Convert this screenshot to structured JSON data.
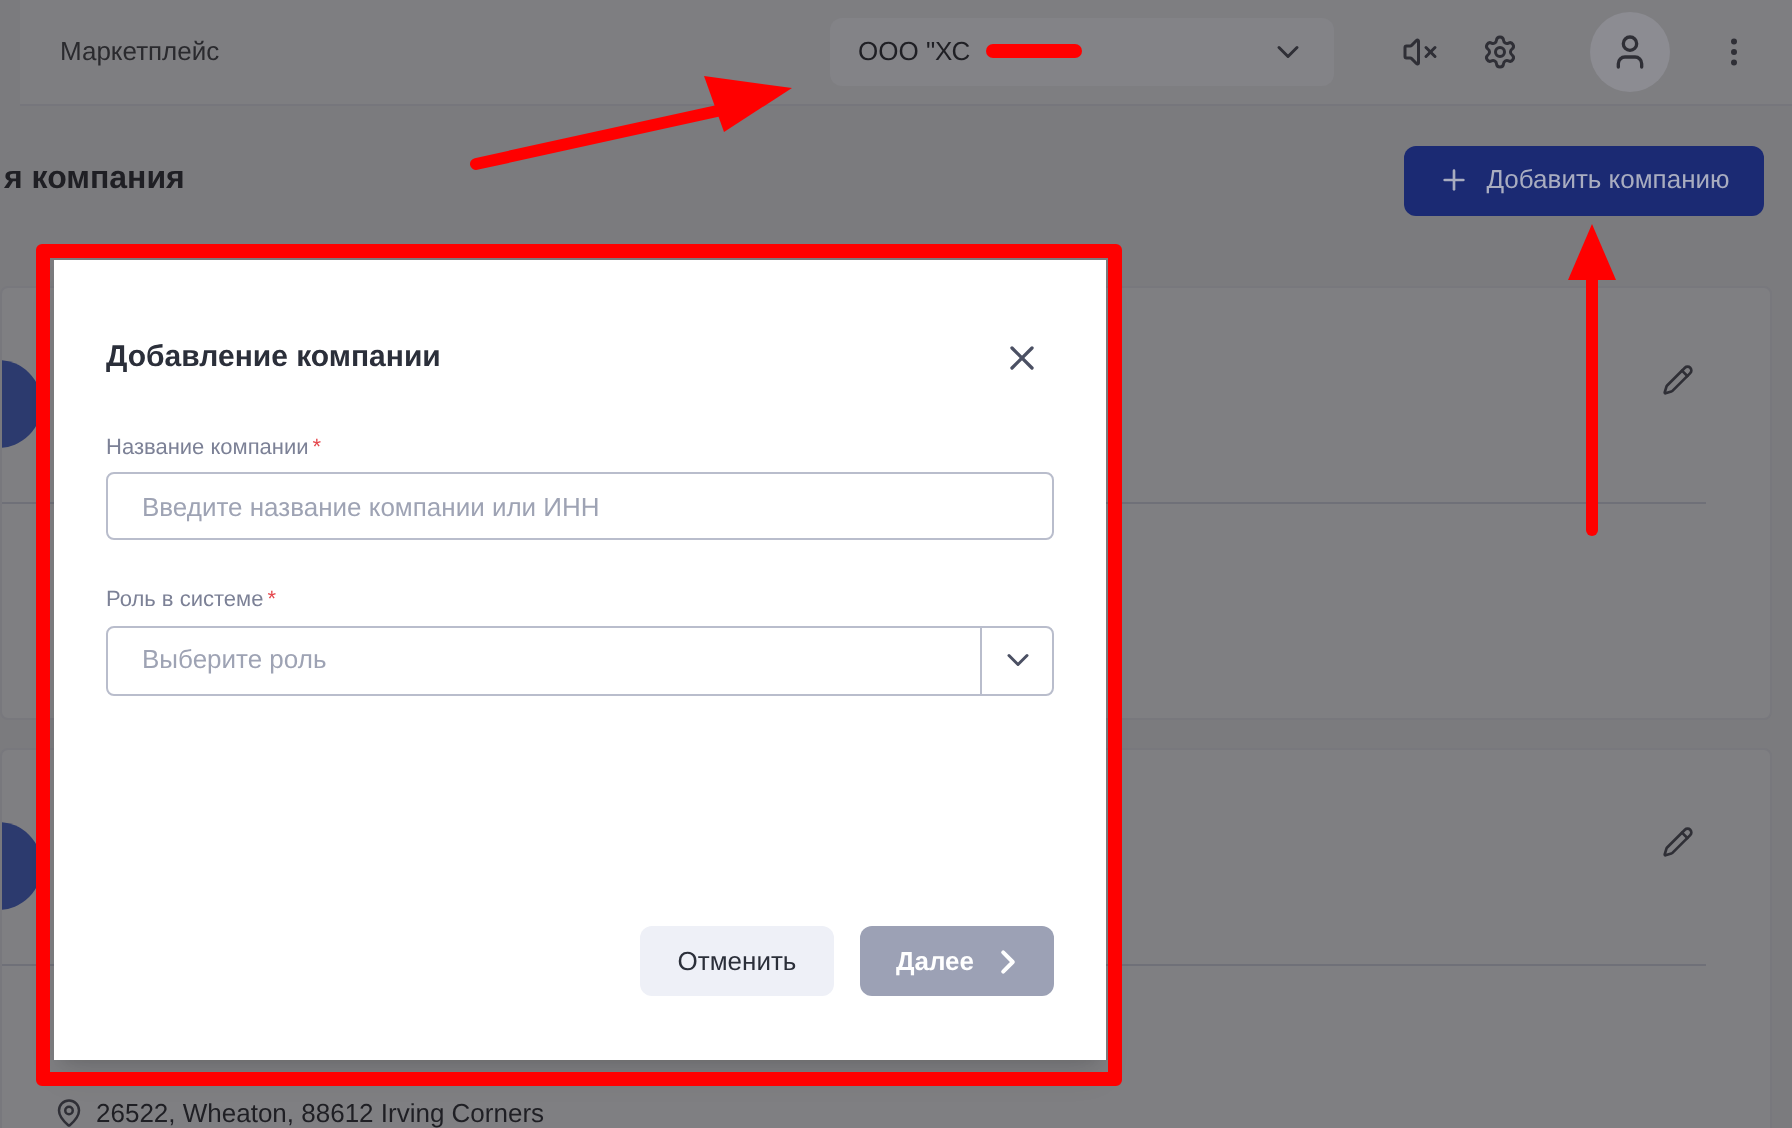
{
  "header": {
    "title": "Маркетплейс",
    "company_select": {
      "value": "ООО \"ХС"
    }
  },
  "page": {
    "title": "я компания",
    "add_button": "Добавить компанию"
  },
  "cards": [
    {
      "kind": "plain"
    },
    {
      "kind": "address",
      "address": "26522, Wheaton, 88612 Irving Corners"
    }
  ],
  "modal": {
    "title": "Добавление компании",
    "fields": [
      {
        "kind": "text",
        "label": "Название компании",
        "required_mark": "*",
        "placeholder": "Введите название компании или ИНН"
      },
      {
        "kind": "select",
        "label": "Роль в системе",
        "required_mark": "*",
        "placeholder": "Выберите роль"
      }
    ],
    "buttons": [
      {
        "kind": "secondary",
        "label": "Отменить",
        "disabled": false
      },
      {
        "kind": "primary",
        "label": "Далее",
        "disabled": true
      }
    ]
  }
}
